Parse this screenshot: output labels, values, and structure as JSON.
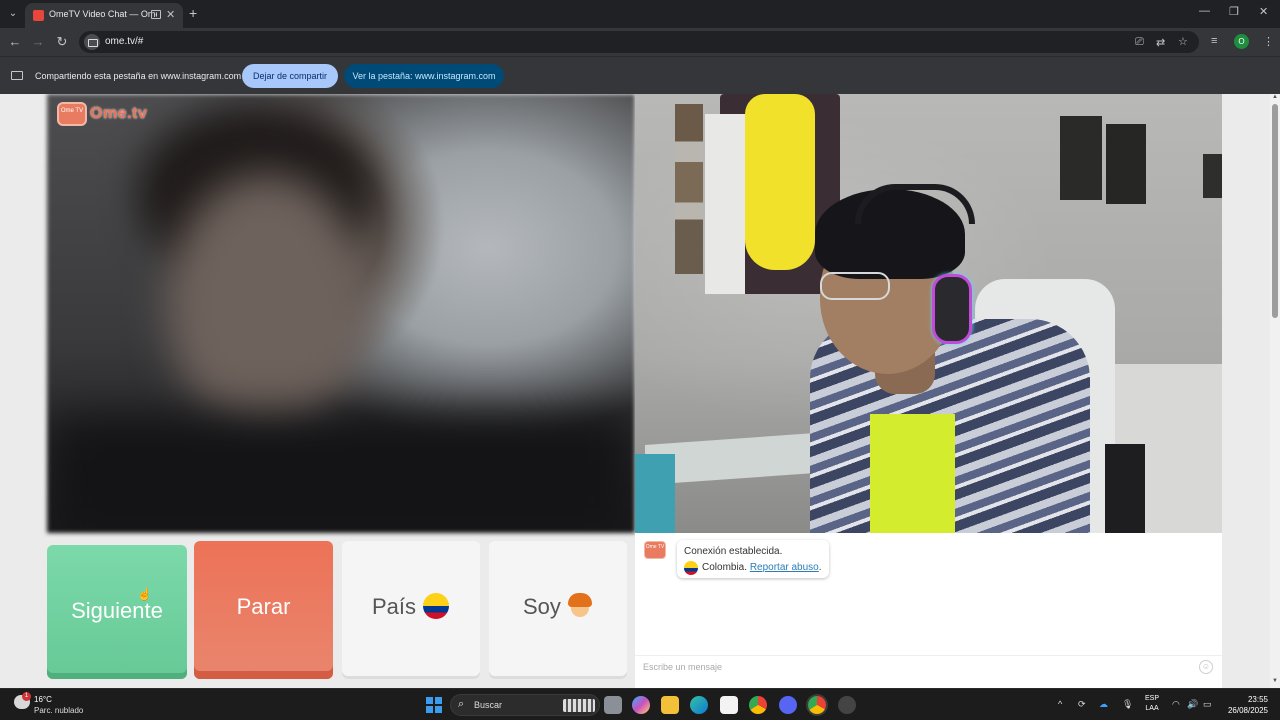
{
  "browser": {
    "tab_title": "OmeTV Video Chat — Ome",
    "url": "ome.tv/#",
    "profile_initial": "O"
  },
  "infobar": {
    "message": "Compartiendo esta pestaña en www.instagram.com",
    "stop_label": "Dejar de compartir",
    "view_label": "Ver la pestaña: www.instagram.com"
  },
  "app": {
    "logo_text": "Ome.tv",
    "logo_badge": "Ome TV"
  },
  "controls": {
    "next_label": "Siguiente",
    "stop_label": "Parar",
    "country_label": "País",
    "gender_label": "Soy"
  },
  "chat": {
    "status": "Conexión establecida.",
    "country": "Colombia.",
    "report_label": "Reportar abuso",
    "report_suffix": ".",
    "input_placeholder": "Escribe un mensaje"
  },
  "taskbar": {
    "temperature": "16°C",
    "weather": "Parc. nublado",
    "weather_badge": "1",
    "search_label": "Buscar",
    "lang_line1": "ESP",
    "lang_line2": "LAA",
    "time": "23:55",
    "date": "26/08/2025"
  },
  "colors": {
    "next": "#6fd1a0",
    "stop": "#ea7a60",
    "accent_link": "#2a7db7"
  }
}
